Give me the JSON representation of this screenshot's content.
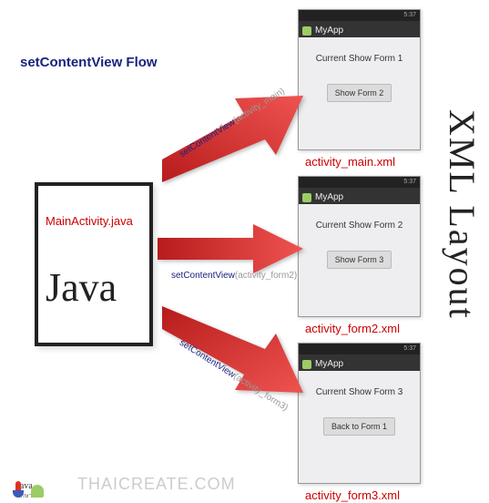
{
  "title": "setContentView Flow",
  "javaBox": {
    "file": "MainActivity.java",
    "logo": "Java"
  },
  "sideTitle": "XML Layout",
  "phones": {
    "appName": "MyApp",
    "statusTime": "5:37",
    "p1": {
      "text": "Current Show Form 1",
      "button": "Show Form 2",
      "xml": "activity_main.xml"
    },
    "p2": {
      "text": "Current Show Form 2",
      "button": "Show Form 3",
      "xml": "activity_form2.xml"
    },
    "p3": {
      "text": "Current Show Form 3",
      "button": "Back to Form 1",
      "xml": "activity_form3.xml"
    }
  },
  "arrows": {
    "a1": {
      "call": "setContentView",
      "arg": "(activity_main)"
    },
    "a2": {
      "call": "setContentView",
      "arg": "(activity_form2)"
    },
    "a3": {
      "call": "setContentView",
      "arg": "(activity_form3)"
    }
  },
  "footer": {
    "watermark": "THAICREATE.COM",
    "javaSmall": "Java",
    "thai": "ยกษา"
  }
}
